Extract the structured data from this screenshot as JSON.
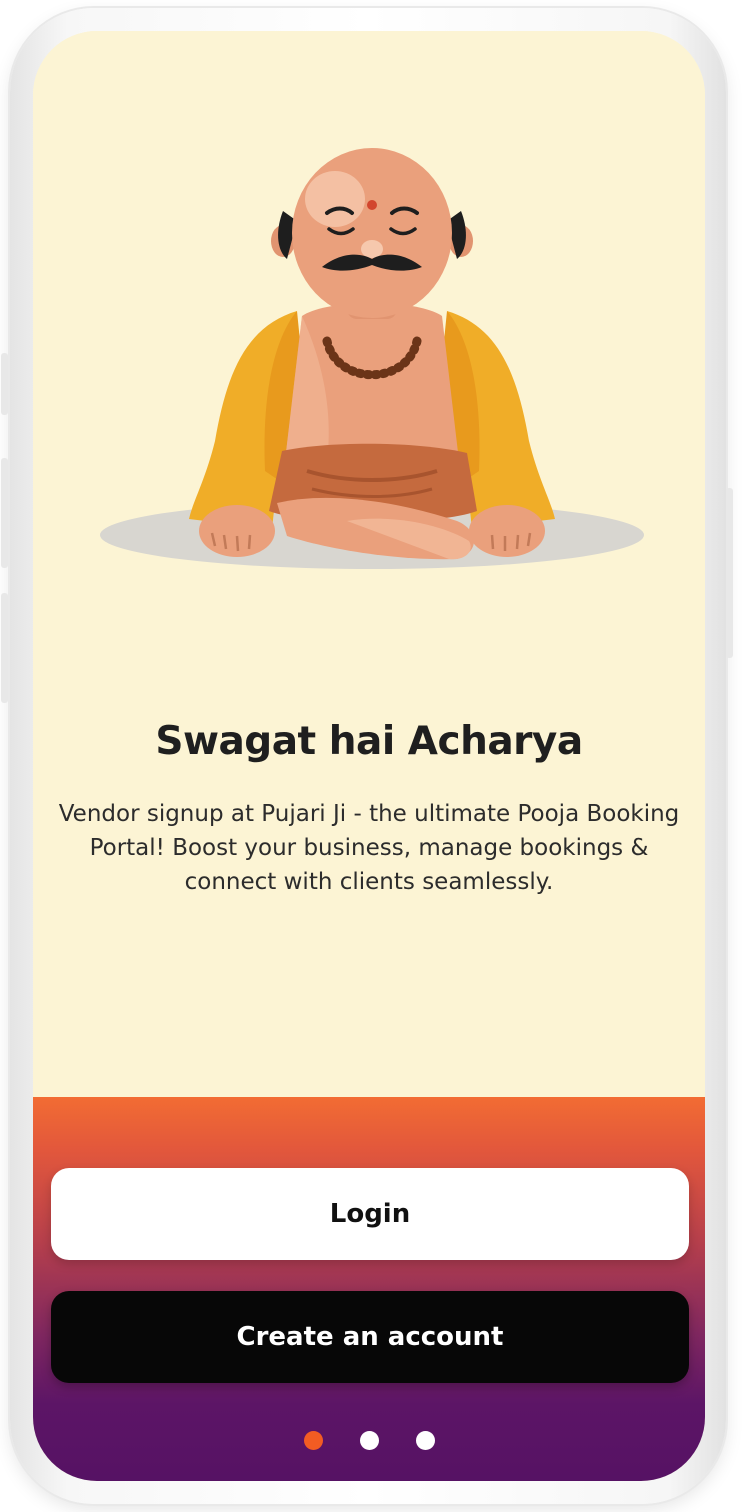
{
  "welcome": {
    "title": "Swagat hai Acharya",
    "description": "Vendor signup at Pujari Ji - the ultimate Pooja Booking Portal! Boost your business, manage bookings & connect with clients seamlessly."
  },
  "actions": {
    "login_label": "Login",
    "create_account_label": "Create an account"
  },
  "pager": {
    "page_count": 3,
    "active_index": 0
  },
  "colors": {
    "background": "#fcf4d4",
    "gradient_top": "#f26c33",
    "gradient_bottom": "#561264",
    "active_dot": "#f25c23",
    "inactive_dot": "#ffffff",
    "primary_button": "#070707",
    "secondary_button": "#ffffff"
  },
  "icons": {
    "illustration": "meditating-priest-illustration"
  }
}
